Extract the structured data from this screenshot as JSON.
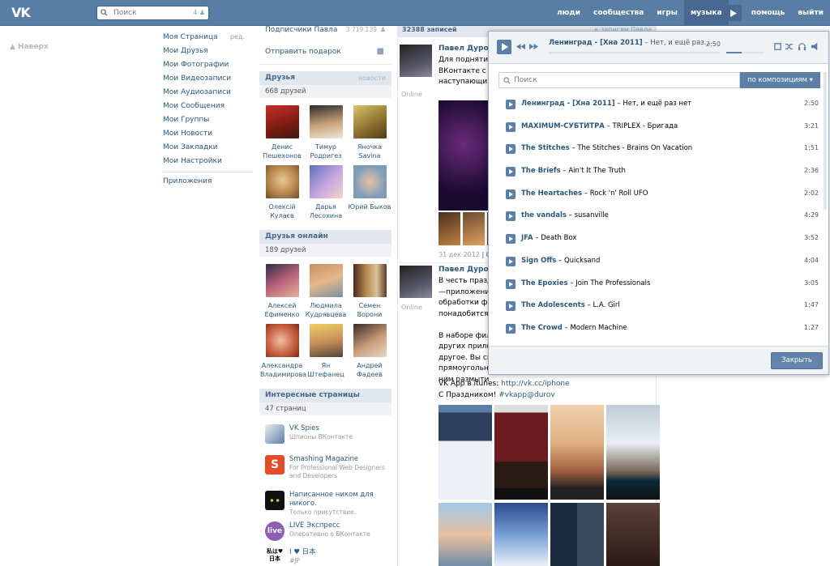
{
  "header": {
    "logo": "VK",
    "search_placeholder": "Поиск",
    "search_count": "4",
    "nav": [
      "люди",
      "сообщества",
      "игры",
      "музыка",
      "помощь",
      "выйти"
    ],
    "active_nav": "музыка"
  },
  "left": {
    "up_label": "Наверх",
    "edit_label": "ред.",
    "menu": [
      "Моя Страница",
      "Мои Друзья",
      "Мои Фотографии",
      "Мои Видеозаписи",
      "Мои Аудиозаписи",
      "Мои Сообщения",
      "Мои Группы",
      "Мои Новости",
      "Мои Закладки",
      "Мои Настройки"
    ],
    "apps": "Приложения"
  },
  "col2": {
    "subscribers": "Подписчики Павла",
    "subscribers_count": "3 719 139",
    "send_gift": "Отправить подарок",
    "friends_title": "Друзья",
    "friends_news": "новости",
    "friends_count": "668 друзей",
    "friends": [
      {
        "name": "Денис Пешехонов"
      },
      {
        "name": "Тимур Родригез"
      },
      {
        "name": "Яночка Savina"
      },
      {
        "name": "Олексій Кулаєв"
      },
      {
        "name": "Дарья Лесохина"
      },
      {
        "name": "Юрий Быков"
      }
    ],
    "online_title": "Друзья онлайн",
    "online_count": "189 друзей",
    "online": [
      {
        "name": "Алексей Ефименко"
      },
      {
        "name": "Людмила Кудрявцева"
      },
      {
        "name": "Семен Ворони"
      },
      {
        "name": "Александра Владимирова"
      },
      {
        "name": "Ян Штефанец"
      },
      {
        "name": "Андрей Фадеев"
      }
    ],
    "pages_title": "Интересные страницы",
    "pages_count": "47 страниц",
    "pages": [
      {
        "title": "VK Spies",
        "desc": "Шпионы ВКонтакте"
      },
      {
        "title": "Smashing Magazine",
        "desc": "For Professional Web Designers and Developers"
      },
      {
        "title": "Написанное ником для никого.",
        "desc": "Только присутствие."
      },
      {
        "title": "LIVE Экспресс",
        "desc": "Оперативно о ВКонтакте"
      },
      {
        "title": "I ♥ 日本",
        "desc": "#JP"
      }
    ],
    "page_logo_live": "live",
    "page_logo_jp": "私は♥日本"
  },
  "feed": {
    "records": "32388 записей",
    "to_records": "к записям Павла",
    "post1": {
      "author": "Павел Дуров",
      "online": "Online",
      "text": "Для поднятия н\nВКонтакте с пр\nнаступающим!",
      "date": "31 дек 2012",
      "sep": "| О"
    },
    "post2": {
      "author": "Павел Дуров",
      "online": "Online",
      "text": "В честь праздн\n—приложени\nобработки фот\nпонадобится з\n\nВ наборе филь\nдругих прилож\nдругое. Вы смо\nпрямоугольны\nним размытие",
      "itunes_label": "VK App в itunes:",
      "itunes_link": "http://vk.cc/iphone",
      "holiday": "С Праздником!",
      "hashtag": "#vkapp@durov"
    }
  },
  "player": {
    "current_artist": "Ленинград - [Хна 2011]",
    "current_title": "Нет, и ещё раз...",
    "current_time": "2:50",
    "volume": 0.4,
    "search_placeholder": "Поиск",
    "search_by": "по композициям",
    "tracks": [
      {
        "artist": "Ленинград - [Хна 2011]",
        "title": "Нет, и ещё раз нет",
        "time": "2:50"
      },
      {
        "artist": "MAXIMUM-СУБТИТРА",
        "title": "TRIPLEX - Бригада",
        "time": "3:21"
      },
      {
        "artist": "The Stitches",
        "title": "The Stitches - Brains On Vacation",
        "time": "1:51"
      },
      {
        "artist": "The Briefs",
        "title": "Ain't It The Truth",
        "time": "2:36"
      },
      {
        "artist": "The Heartaches",
        "title": "Rock 'n' Roll UFO",
        "time": "2:02"
      },
      {
        "artist": "the vandals",
        "title": "susanville",
        "time": "4:29"
      },
      {
        "artist": "JFA",
        "title": "Death Box",
        "time": "3:52"
      },
      {
        "artist": "Sign Offs",
        "title": "Quicksand",
        "time": "4:04"
      },
      {
        "artist": "The Epoxies",
        "title": "Join The Professionals",
        "time": "3:05"
      },
      {
        "artist": "The Adolescents",
        "title": "L.A. Girl",
        "time": "1:47"
      },
      {
        "artist": "The Crowd",
        "title": "Modern Machine",
        "time": "1:27"
      }
    ],
    "close": "Закрыть"
  }
}
